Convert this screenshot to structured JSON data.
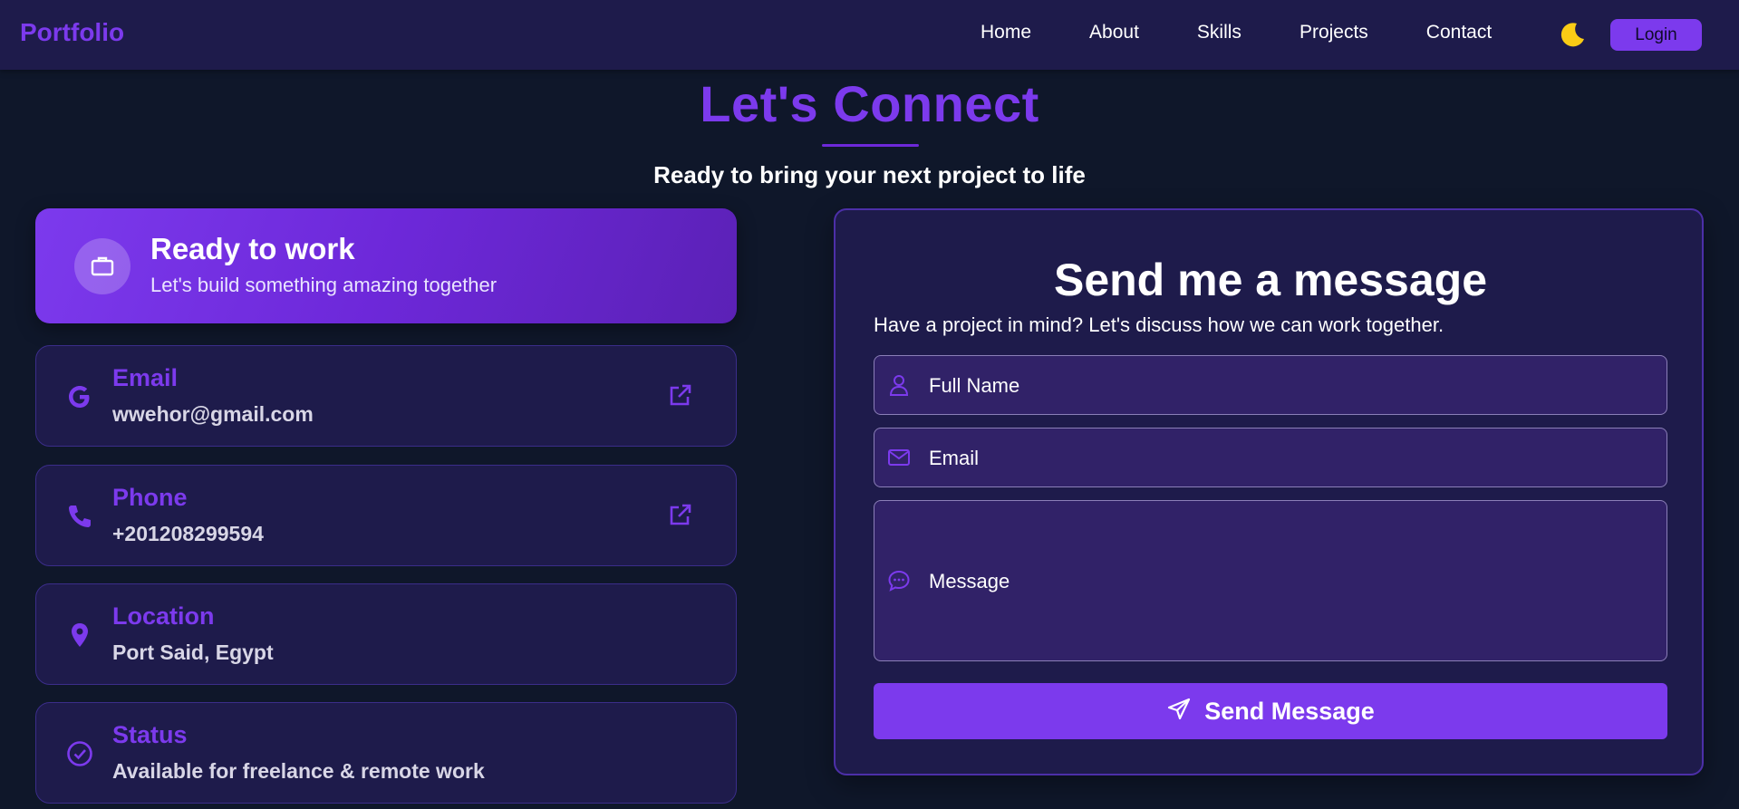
{
  "navbar": {
    "brand": "Portfolio",
    "links": [
      "Home",
      "About",
      "Skills",
      "Projects",
      "Contact"
    ],
    "theme_icon": "moon-icon",
    "login_label": "Login"
  },
  "heading": {
    "title": "Let's Connect",
    "subtitle": "Ready to bring your next project to life"
  },
  "ready_card": {
    "icon": "briefcase-icon",
    "title": "Ready to work",
    "subtitle": "Let's build something amazing together"
  },
  "contact_items": [
    {
      "icon": "google-icon",
      "label": "Email",
      "value": "wwehor@gmail.com",
      "has_link": true
    },
    {
      "icon": "phone-icon",
      "label": "Phone",
      "value": "+201208299594",
      "has_link": true
    },
    {
      "icon": "location-pin-icon",
      "label": "Location",
      "value": "Port Said, Egypt",
      "has_link": false
    },
    {
      "icon": "check-circle-icon",
      "label": "Status",
      "value": "Available for freelance & remote work",
      "has_link": false
    }
  ],
  "form": {
    "title": "Send me a message",
    "subtitle": "Have a project in mind? Let's discuss how we can work together.",
    "name_placeholder": "Full Name",
    "email_placeholder": "Email",
    "message_placeholder": "Message",
    "submit_label": "Send Message"
  },
  "colors": {
    "accent": "#7c3aed",
    "page_bg": "#0f172a",
    "card_bg": "#1e1b4b",
    "input_bg": "#312268",
    "theme_icon": "#facc15"
  }
}
